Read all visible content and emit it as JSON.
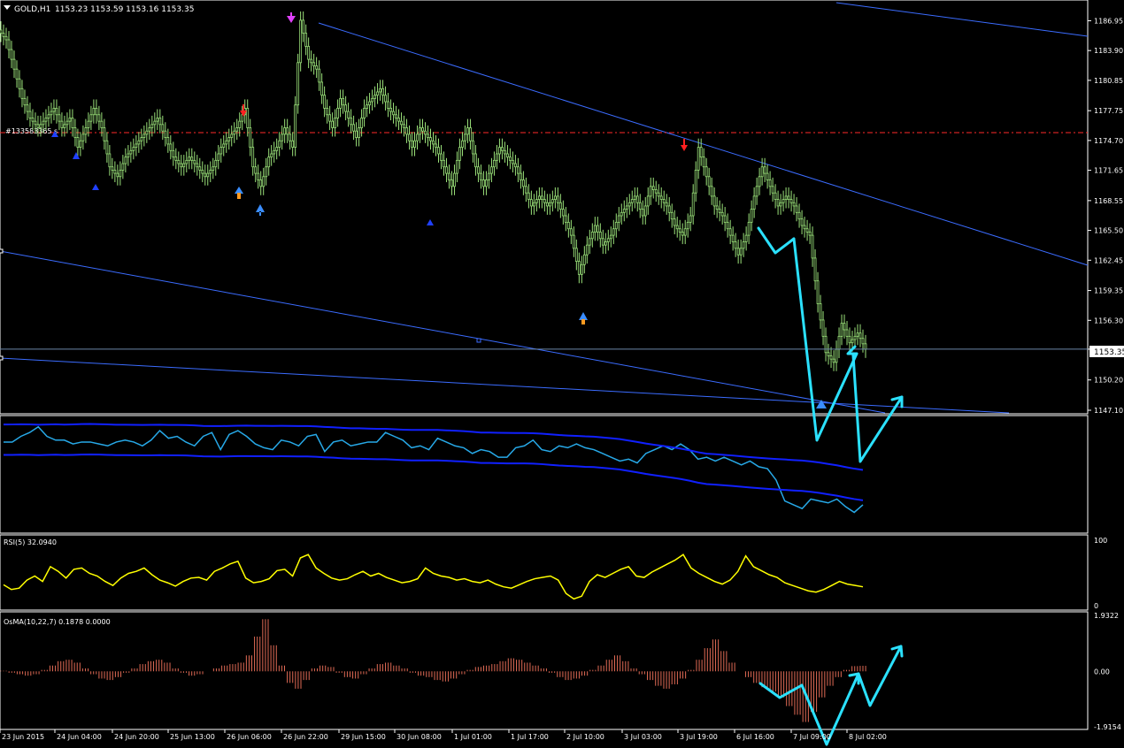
{
  "header": {
    "symbol": "GOLD,H1",
    "quote": "1153.23 1153.59 1153.16 1153.35",
    "order_line_label": "#133583365 s"
  },
  "indicators": {
    "envelope_label": "",
    "rsi_label": "RSI(5) 32.0940",
    "osma_label": "OsMA(10,22,7) 0.1878 0.0000"
  },
  "colors": {
    "background": "#000000",
    "grid_frame": "#ffffff",
    "candle": "#9be27a",
    "trendline": "#3b6cff",
    "order_line": "#ff2a2a",
    "band": "#1020ff",
    "price_in_band": "#27a9e8",
    "rsi": "#ffff00",
    "osma": "#e06a55",
    "annotation": "#2be1ff"
  },
  "chart_data": [
    {
      "type": "candlestick",
      "title": "",
      "symbol": "GOLD",
      "timeframe": "H1",
      "ylim": [
        1147.1,
        1188.8
      ],
      "yticks": [
        1186.95,
        1183.9,
        1180.85,
        1177.75,
        1174.7,
        1171.65,
        1168.55,
        1165.5,
        1162.45,
        1159.35,
        1156.3,
        1153.35,
        1150.2,
        1147.1
      ],
      "current_price": 1153.35,
      "order_line_price": 1175.5,
      "x_labels": [
        "23 Jun 2015",
        "24 Jun 04:00",
        "24 Jun 20:00",
        "25 Jun 13:00",
        "26 Jun 06:00",
        "26 Jun 22:00",
        "29 Jun 15:00",
        "30 Jun 08:00",
        "1 Jul 01:00",
        "1 Jul 17:00",
        "2 Jul 10:00",
        "3 Jul 03:00",
        "3 Jul 19:00",
        "6 Jul 16:00",
        "7 Jul 09:00",
        "8 Jul 02:00"
      ],
      "close_series": [
        1185,
        1182,
        1179,
        1177,
        1176,
        1177,
        1178,
        1176,
        1177,
        1174,
        1176,
        1178,
        1176,
        1172,
        1171,
        1173,
        1174,
        1175,
        1176,
        1177,
        1175,
        1173,
        1172,
        1173,
        1172,
        1171,
        1172,
        1174,
        1175,
        1176,
        1178,
        1172,
        1170,
        1173,
        1174,
        1176,
        1174,
        1187,
        1183,
        1182,
        1178,
        1176,
        1179,
        1177,
        1175,
        1178,
        1179,
        1180,
        1178,
        1177,
        1176,
        1174,
        1176,
        1175,
        1174,
        1172,
        1170,
        1174,
        1176,
        1172,
        1170,
        1172,
        1174,
        1173,
        1172,
        1170,
        1168,
        1169,
        1168,
        1169,
        1167,
        1165,
        1161,
        1164,
        1166,
        1164,
        1165,
        1167,
        1168,
        1169,
        1167,
        1170,
        1169,
        1168,
        1166,
        1165,
        1167,
        1174,
        1171,
        1168,
        1167,
        1165,
        1163,
        1165,
        1169,
        1172,
        1170,
        1168,
        1169,
        1168,
        1166,
        1165,
        1158,
        1153,
        1152,
        1156,
        1154,
        1155,
        1153.35
      ]
    },
    {
      "type": "line",
      "title": "",
      "note": "price with envelope bands",
      "series_values": [
        57,
        57,
        60,
        62,
        65,
        60,
        58,
        58,
        56,
        57,
        57,
        56,
        55,
        57,
        58,
        57,
        55,
        58,
        63,
        59,
        60,
        57,
        55,
        60,
        62,
        53,
        61,
        63,
        60,
        56,
        54,
        53,
        58,
        57,
        55,
        60,
        61,
        52,
        57,
        58,
        55,
        56,
        57,
        57,
        62,
        60,
        58,
        54,
        55,
        53,
        59,
        57,
        55,
        54,
        51,
        53,
        52,
        49,
        49,
        54,
        55,
        58,
        53,
        52,
        55,
        54,
        56,
        54,
        53,
        51,
        49,
        47,
        48,
        46,
        51,
        53,
        55,
        53,
        56,
        53,
        48,
        49,
        47,
        49,
        47,
        45,
        47,
        44,
        43,
        37,
        26,
        24,
        22,
        27,
        26,
        25,
        27,
        23,
        20,
        24
      ]
    },
    {
      "type": "line",
      "title": "",
      "series": [
        {
          "name": "RSI(5)",
          "last": 32.094
        }
      ],
      "ylim": [
        0,
        100
      ],
      "yticks": [
        100,
        0
      ],
      "values": [
        35,
        28,
        30,
        42,
        48,
        40,
        62,
        55,
        45,
        58,
        60,
        52,
        48,
        40,
        34,
        45,
        52,
        55,
        60,
        50,
        42,
        38,
        33,
        40,
        45,
        46,
        42,
        55,
        60,
        66,
        70,
        45,
        38,
        40,
        44,
        56,
        58,
        48,
        75,
        80,
        60,
        52,
        45,
        42,
        44,
        50,
        55,
        48,
        52,
        46,
        42,
        38,
        40,
        44,
        60,
        52,
        48,
        46,
        42,
        44,
        40,
        38,
        42,
        36,
        32,
        30,
        35,
        40,
        44,
        46,
        48,
        42,
        22,
        14,
        18,
        40,
        50,
        46,
        52,
        58,
        62,
        48,
        46,
        54,
        60,
        66,
        72,
        80,
        60,
        52,
        46,
        40,
        36,
        42,
        55,
        78,
        62,
        56,
        50,
        46,
        38,
        34,
        30,
        26,
        24,
        28,
        34,
        40,
        36,
        34,
        32
      ]
    },
    {
      "type": "bar",
      "title": "",
      "series": [
        {
          "name": "OsMA(10,22,7)",
          "value": 0.1878,
          "signal": 0.0
        }
      ],
      "ylim": [
        -1.9154,
        1.9322
      ],
      "yticks": [
        1.9322,
        0.0,
        -1.9154
      ],
      "values": [
        0.02,
        -0.05,
        -0.1,
        -0.15,
        -0.1,
        0.05,
        0.2,
        0.35,
        0.4,
        0.3,
        0.1,
        -0.1,
        -0.25,
        -0.3,
        -0.2,
        -0.05,
        0.1,
        0.25,
        0.35,
        0.4,
        0.3,
        0.1,
        -0.05,
        -0.15,
        -0.1,
        0.0,
        0.1,
        0.2,
        0.25,
        0.3,
        0.55,
        1.2,
        1.8,
        0.9,
        0.2,
        -0.4,
        -0.6,
        -0.3,
        0.1,
        0.2,
        0.15,
        -0.05,
        -0.2,
        -0.25,
        -0.1,
        0.1,
        0.25,
        0.3,
        0.2,
        0.1,
        -0.05,
        -0.15,
        -0.2,
        -0.3,
        -0.35,
        -0.25,
        -0.1,
        0.05,
        0.15,
        0.2,
        0.25,
        0.35,
        0.45,
        0.4,
        0.3,
        0.2,
        0.1,
        -0.05,
        -0.2,
        -0.3,
        -0.25,
        -0.15,
        0.05,
        0.2,
        0.4,
        0.55,
        0.35,
        0.1,
        -0.1,
        -0.3,
        -0.5,
        -0.6,
        -0.45,
        -0.25,
        0.05,
        0.4,
        0.8,
        1.1,
        0.7,
        0.3,
        0.0,
        -0.2,
        -0.4,
        -0.55,
        -0.7,
        -0.9,
        -1.2,
        -1.5,
        -1.75,
        -1.4,
        -0.9,
        -0.5,
        -0.2,
        0.05,
        0.18,
        0.19
      ]
    }
  ]
}
